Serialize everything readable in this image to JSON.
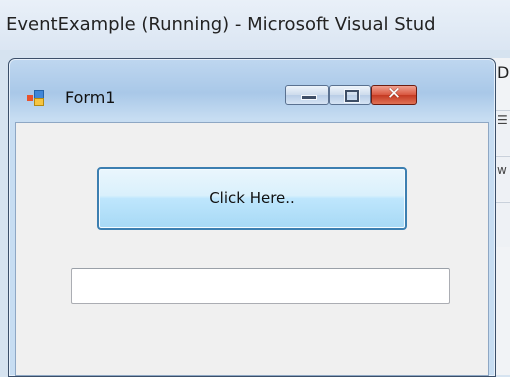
{
  "background_window": {
    "title": "EventExample (Running) - Microsoft Visual Stud",
    "panel_letter": "D",
    "panel_glyph_1": "☰",
    "panel_glyph_2": "w"
  },
  "form": {
    "title": "Form1",
    "icon": "winforms-app-icon",
    "caption_buttons": {
      "minimize_icon": "minimize-icon",
      "maximize_icon": "maximize-icon",
      "close_icon": "close-icon",
      "close_glyph": "✕"
    },
    "button_label": "Click Here..",
    "textbox_value": ""
  },
  "colors": {
    "button_border": "#3c7fb1",
    "close_button": "#c43a22",
    "window_frame": "#a9c8e8"
  }
}
